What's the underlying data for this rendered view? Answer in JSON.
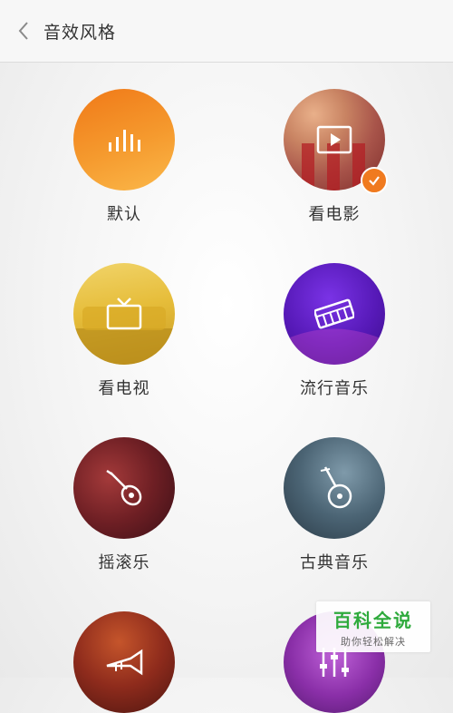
{
  "header": {
    "title": "音效风格",
    "back_icon": "chevron-left-icon"
  },
  "presets": [
    {
      "label": "默认",
      "icon": "sound-bars-icon",
      "selected": false
    },
    {
      "label": "看电影",
      "icon": "movie-play-icon",
      "selected": true
    },
    {
      "label": "看电视",
      "icon": "tv-icon",
      "selected": false
    },
    {
      "label": "流行音乐",
      "icon": "keyboard-icon",
      "selected": false
    },
    {
      "label": "摇滚乐",
      "icon": "guitar-icon",
      "selected": false
    },
    {
      "label": "古典音乐",
      "icon": "pipa-icon",
      "selected": false
    },
    {
      "label": "",
      "icon": "trumpet-icon",
      "selected": false
    },
    {
      "label": "",
      "icon": "equalizer-icon",
      "selected": false
    }
  ],
  "watermark": {
    "title": "百科全说",
    "subtitle": "助你轻松解决"
  },
  "colors": {
    "accent": "#f07a1f",
    "watermark_green": "#2eaa3c"
  }
}
